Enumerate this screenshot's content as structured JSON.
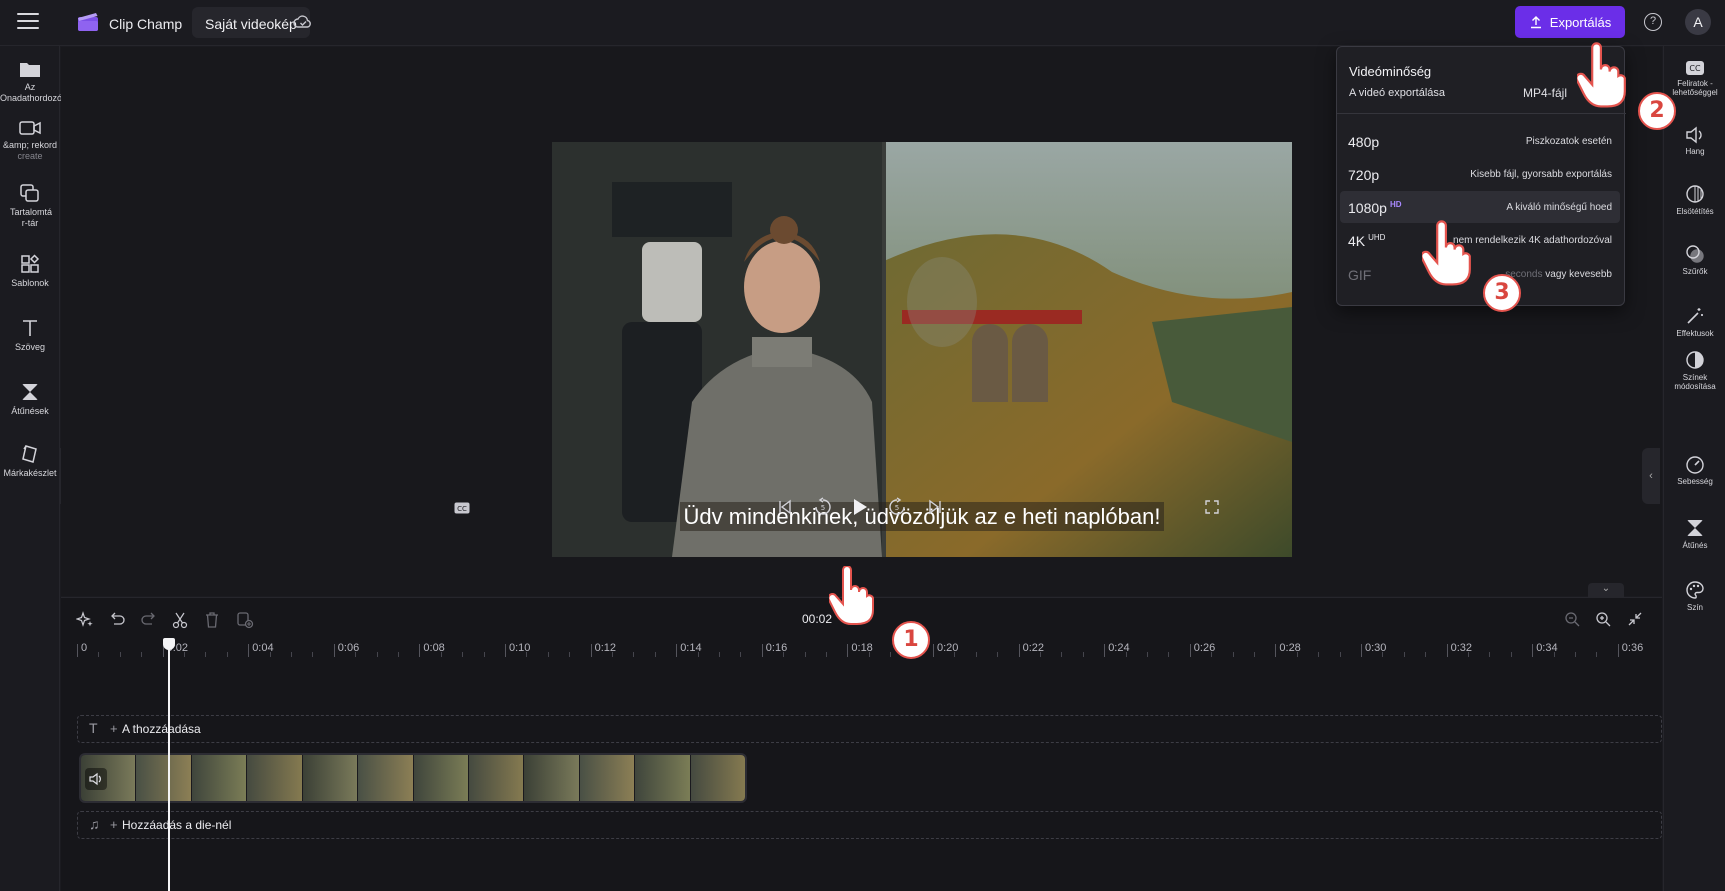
{
  "app": {
    "title": "Clip Champ",
    "project_name": "Saját videokép"
  },
  "topbar": {
    "export_label": "Exportálás",
    "help_glyph": "?",
    "avatar_initial": "A",
    "export_color": "#6b2ee8"
  },
  "left_sidebar": [
    {
      "label": "Az Onadathordozója",
      "sub": "",
      "icon": "folder-icon"
    },
    {
      "label": "&amp; rekord",
      "sub": "create",
      "icon": "camera-icon"
    },
    {
      "label": "Tartalomtá r-tár",
      "sub": "",
      "icon": "content-library-icon"
    },
    {
      "label": "Sablonok",
      "sub": "",
      "icon": "templates-icon"
    },
    {
      "label": "Szöveg",
      "sub": "",
      "icon": "text-icon"
    },
    {
      "label": "Átűnések",
      "sub": "",
      "icon": "transitions-icon"
    },
    {
      "label": "Márkakészlet",
      "sub": "",
      "icon": "brand-kit-icon"
    }
  ],
  "right_sidebar": [
    {
      "label": "Feliratok - lehetőséggel",
      "icon": "captions-icon"
    },
    {
      "label": "Hang",
      "icon": "audio-icon"
    },
    {
      "label": "Elsötétítés",
      "icon": "fade-icon"
    },
    {
      "label": "Szűrők",
      "icon": "filters-icon"
    },
    {
      "label": "Effektusok",
      "icon": "effects-icon"
    },
    {
      "label": "Színek módosítása",
      "icon": "adjust-colors-icon"
    },
    {
      "label": "Sebesség",
      "icon": "speed-icon"
    },
    {
      "label": "Átűnés",
      "icon": "transition-icon"
    },
    {
      "label": "Szín",
      "icon": "color-palette-icon"
    }
  ],
  "preview": {
    "caption": "Üdv mindenkinek, üdvözöljük az e heti naplóban!"
  },
  "timeline": {
    "timecode": "00:02",
    "ticks": [
      "0",
      "0:02",
      "0:04",
      "0:06",
      "0:08",
      "0:10",
      "0:12",
      "0:14",
      "0:16",
      "0:18",
      "0:20",
      "0:22",
      "0:24",
      "0:26",
      "0:28",
      "0:30",
      "0:32",
      "0:34",
      "0:36"
    ],
    "text_track_label": "A ͏thozzáadása",
    "audio_track_label": "Hozzáadás a die-nél",
    "plus_glyph": "+",
    "text_track_glyph": "T",
    "audio_track_glyph": "♫"
  },
  "export_dropdown": {
    "title": "Videóminőség",
    "subtitle": "A videó exportálása",
    "format": "MP4-fájl",
    "options": [
      {
        "res": "480p",
        "badge": "",
        "desc": "Piszkozatok esetén",
        "desc_extra": ""
      },
      {
        "res": "720p",
        "badge": "",
        "desc": "Kisebb fájl, gyorsabb exportálás",
        "desc_extra": ""
      },
      {
        "res": "1080p",
        "badge": "HD",
        "desc": "A kiváló minőségű hoed",
        "desc_extra": ""
      },
      {
        "res": "4K",
        "badge": "UHD",
        "desc": "nem rendelkezik 4K adathordozóval",
        "desc_extra": ""
      },
      {
        "res": "GIF",
        "badge": "",
        "desc": "seconds",
        "desc_extra": "vagy kevesebb"
      }
    ]
  },
  "annotations": {
    "step1": "1",
    "step2": "2",
    "step3": "3"
  }
}
